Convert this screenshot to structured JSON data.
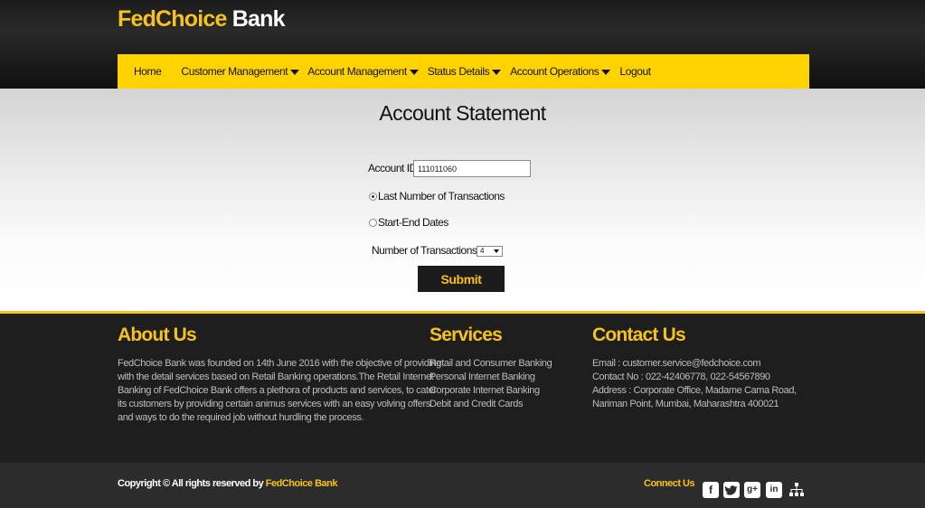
{
  "brand": {
    "part1": "FedChoice",
    "part2": "Bank",
    "accent": "#f7c21b"
  },
  "nav": [
    {
      "label": "Home",
      "dropdown": false
    },
    {
      "label": "Customer Management",
      "dropdown": true
    },
    {
      "label": "Account Management",
      "dropdown": true
    },
    {
      "label": "Status Details",
      "dropdown": true
    },
    {
      "label": "Account Operations",
      "dropdown": true
    },
    {
      "label": "Logout",
      "dropdown": false
    }
  ],
  "form": {
    "title": "Account Statement",
    "account_id_label": "Account ID :",
    "account_id_value": "111011060",
    "radio_last": "Last Number of Transactions",
    "radio_dates": "Start-End Dates",
    "selected_option": "last",
    "num_tx_label": "Number of Transactions",
    "num_tx_value": "4",
    "submit_label": "Submit"
  },
  "footer": {
    "about_title": "About Us",
    "about_lines": [
      "FedChoice Bank was founded on 14th June 2016 with the objective of providing",
      "with the detail services based on Retail Banking operations.The Retail Internet",
      "Banking of FedChoice Bank offers a plethora of products and services, to cater",
      "its customers by providing certain animus services with an easy volving offers",
      "and ways to do the required job without hurdling the process."
    ],
    "services_title": "Services",
    "services": [
      "Retail and Consumer Banking",
      "Personal Internet Banking",
      "Corporate Internet Banking",
      "Debit and Credit Cards"
    ],
    "contact_title": "Contact Us",
    "contact_lines": [
      "Email : customer.service@fedchoice.com",
      "Contact No : 022-42406778, 022-54567890",
      "Address : Corporate Office, Madame Cama Road,",
      "Nariman Point, Mumbai, Maharashtra 400021"
    ]
  },
  "bottom": {
    "copyright_prefix": "Copyright © All rights reserved by",
    "copyright_bank": "FedChoice Bank",
    "connect_label": "Connect Us",
    "social_icons": [
      "facebook-icon",
      "twitter-icon",
      "google-plus-icon",
      "linkedin-icon",
      "sitemap-icon"
    ]
  }
}
